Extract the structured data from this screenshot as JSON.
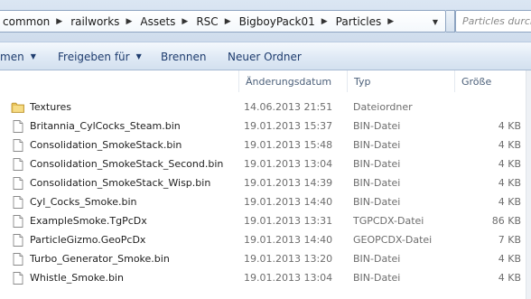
{
  "address": {
    "breadcrumbs": [
      "common",
      "railworks",
      "Assets",
      "RSC",
      "BigboyPack01",
      "Particles"
    ]
  },
  "search": {
    "placeholder": "Particles durchs"
  },
  "commands": {
    "organize": "men",
    "share": "Freigeben für",
    "burn": "Brennen",
    "new_folder": "Neuer Ordner"
  },
  "columns": {
    "date": "Änderungsdatum",
    "type": "Typ",
    "size": "Größe"
  },
  "files": [
    {
      "name": "Textures",
      "date": "14.06.2013 21:51",
      "type": "Dateiordner",
      "size": "",
      "icon": "folder-icon"
    },
    {
      "name": "Britannia_CylCocks_Steam.bin",
      "date": "19.01.2013 15:37",
      "type": "BIN-Datei",
      "size": "4 KB",
      "icon": "file-icon"
    },
    {
      "name": "Consolidation_SmokeStack.bin",
      "date": "19.01.2013 15:48",
      "type": "BIN-Datei",
      "size": "4 KB",
      "icon": "file-icon"
    },
    {
      "name": "Consolidation_SmokeStack_Second.bin",
      "date": "19.01.2013 13:04",
      "type": "BIN-Datei",
      "size": "4 KB",
      "icon": "file-icon"
    },
    {
      "name": "Consolidation_SmokeStack_Wisp.bin",
      "date": "19.01.2013 14:39",
      "type": "BIN-Datei",
      "size": "4 KB",
      "icon": "file-icon"
    },
    {
      "name": "Cyl_Cocks_Smoke.bin",
      "date": "19.01.2013 14:40",
      "type": "BIN-Datei",
      "size": "4 KB",
      "icon": "file-icon"
    },
    {
      "name": "ExampleSmoke.TgPcDx",
      "date": "19.01.2013 13:31",
      "type": "TGPCDX-Datei",
      "size": "86 KB",
      "icon": "file-icon"
    },
    {
      "name": "ParticleGizmo.GeoPcDx",
      "date": "19.01.2013 14:40",
      "type": "GEOPCDX-Datei",
      "size": "7 KB",
      "icon": "file-icon"
    },
    {
      "name": "Turbo_Generator_Smoke.bin",
      "date": "19.01.2013 13:20",
      "type": "BIN-Datei",
      "size": "4 KB",
      "icon": "file-icon"
    },
    {
      "name": "Whistle_Smoke.bin",
      "date": "19.01.2013 13:04",
      "type": "BIN-Datei",
      "size": "4 KB",
      "icon": "file-icon"
    }
  ]
}
